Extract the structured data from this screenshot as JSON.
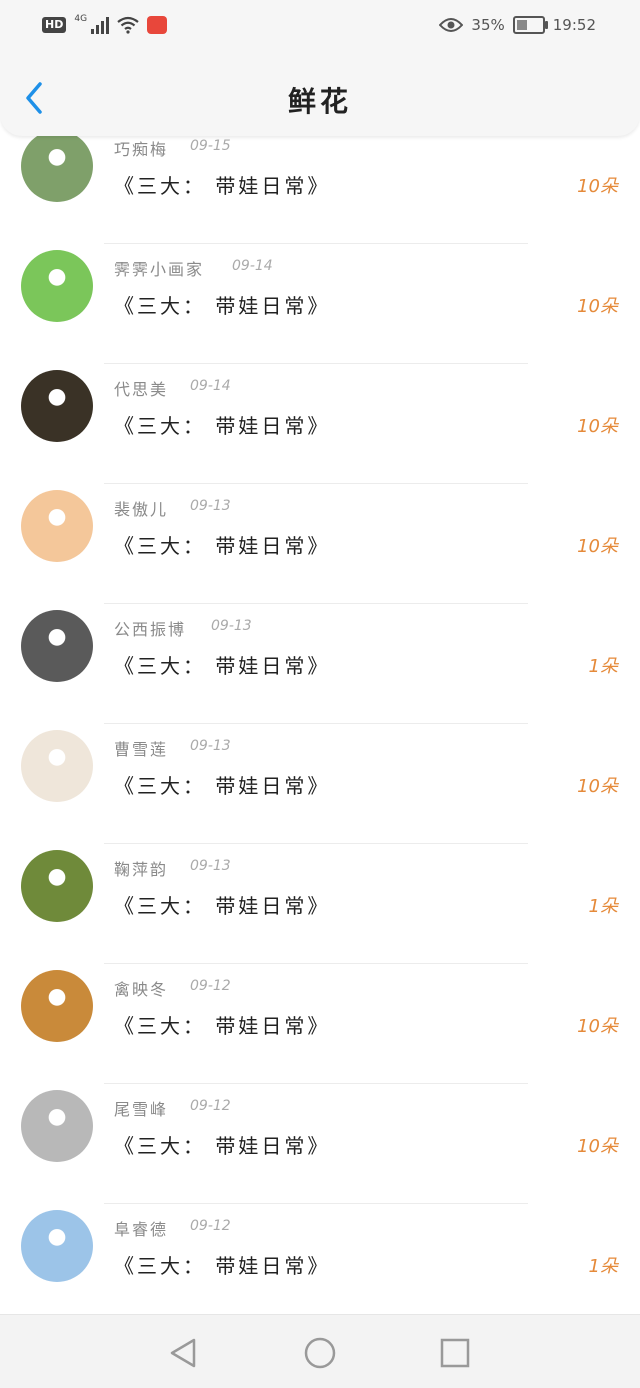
{
  "status_bar": {
    "hd": "HD",
    "network": "4G",
    "battery_text": "35%",
    "time": "19:52",
    "icons": [
      "signal-icon",
      "wifi-icon",
      "app-badge-icon",
      "eye-icon",
      "battery-icon"
    ]
  },
  "header": {
    "title": "鲜花",
    "back_icon": "chevron-left-icon",
    "accent": "#1e90e8"
  },
  "rows": [
    {
      "name": "巧痴梅",
      "date": "09-15",
      "book": "《三大： 带娃日常》",
      "count": "10朵",
      "avatar_color": "#7fa06a"
    },
    {
      "name": "霁霁小画家",
      "date": "09-14",
      "book": "《三大： 带娃日常》",
      "count": "10朵",
      "avatar_color": "#7bc65a"
    },
    {
      "name": "代思美",
      "date": "09-14",
      "book": "《三大： 带娃日常》",
      "count": "10朵",
      "avatar_color": "#3a3226"
    },
    {
      "name": "裴傲儿",
      "date": "09-13",
      "book": "《三大： 带娃日常》",
      "count": "10朵",
      "avatar_color": "#f4c79a"
    },
    {
      "name": "公西振博",
      "date": "09-13",
      "book": "《三大： 带娃日常》",
      "count": "1朵",
      "avatar_color": "#5a5a5a"
    },
    {
      "name": "曹雪莲",
      "date": "09-13",
      "book": "《三大： 带娃日常》",
      "count": "10朵",
      "avatar_color": "#efe6da"
    },
    {
      "name": "鞠萍韵",
      "date": "09-13",
      "book": "《三大： 带娃日常》",
      "count": "1朵",
      "avatar_color": "#6f8a3a"
    },
    {
      "name": "禽映冬",
      "date": "09-12",
      "book": "《三大： 带娃日常》",
      "count": "10朵",
      "avatar_color": "#c98a3a"
    },
    {
      "name": "尾雪峰",
      "date": "09-12",
      "book": "《三大： 带娃日常》",
      "count": "10朵",
      "avatar_color": "#b8b8b8"
    },
    {
      "name": "阜睿德",
      "date": "09-12",
      "book": "《三大： 带娃日常》",
      "count": "1朵",
      "avatar_color": "#9cc4e8"
    }
  ],
  "nav_bar": {
    "icons": [
      "back-triangle-icon",
      "home-circle-icon",
      "recents-square-icon"
    ]
  }
}
